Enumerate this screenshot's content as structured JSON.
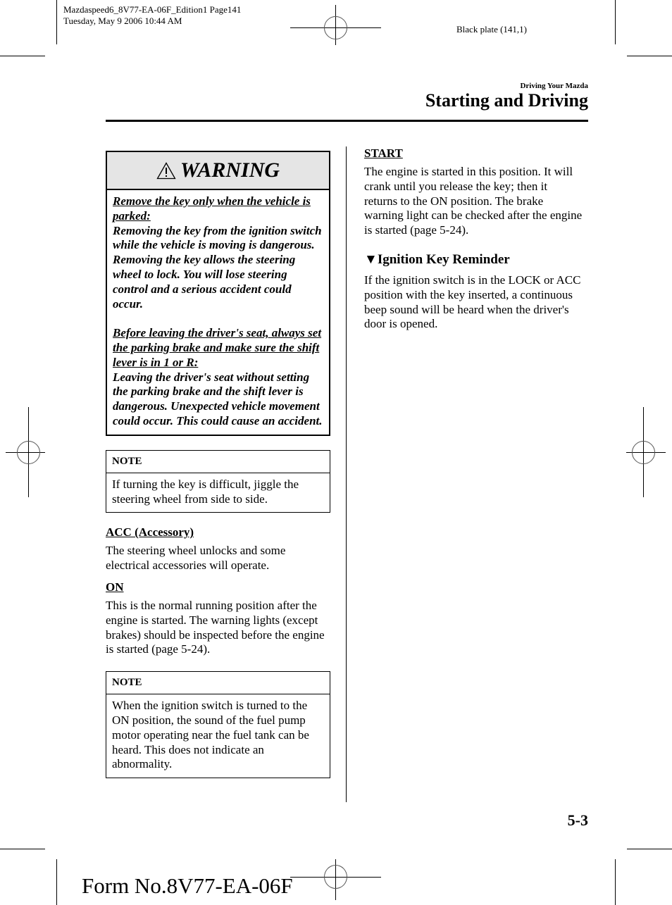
{
  "print_info": {
    "line1": "Mazdaspeed6_8V77-EA-06F_Edition1 Page141",
    "line2": "Tuesday, May 9 2006 10:44 AM",
    "plate": "Black plate (141,1)"
  },
  "header": {
    "chapter": "Driving Your Mazda",
    "section_title": "Starting and Driving"
  },
  "warning": {
    "icon": "warning-triangle-icon",
    "title": "WARNING",
    "blocks": [
      {
        "heading": "Remove the key only when the vehicle is parked:",
        "text": "Removing the key from the ignition switch while the vehicle is moving is dangerous. Removing the key allows the steering wheel to lock. You will lose steering control and a serious accident could occur."
      },
      {
        "heading": "Before leaving the driver's seat, always set the parking brake and make sure the shift lever is in 1 or R:",
        "text": "Leaving the driver's seat without setting the parking brake and the shift lever is dangerous. Unexpected vehicle movement could occur. This could cause an accident."
      }
    ]
  },
  "notes": [
    {
      "label": "NOTE",
      "text": "If turning the key is difficult, jiggle the steering wheel from side to side."
    },
    {
      "label": "NOTE",
      "text": "When the ignition switch is turned to the ON position, the sound of the fuel pump motor operating near the fuel tank can be heard. This does not indicate an abnormality."
    }
  ],
  "positions": {
    "acc": {
      "heading": "ACC (Accessory)",
      "text": "The steering wheel unlocks and some electrical accessories will operate."
    },
    "on": {
      "heading": "ON",
      "text": "This is the normal running position after the engine is started. The warning lights (except brakes) should be inspected before the engine is started (page 5-24)."
    },
    "start": {
      "heading": "START",
      "text": "The engine is started in this position. It will crank until you release the key; then it returns to the ON position. The brake warning light can be checked after the engine is started (page 5-24)."
    }
  },
  "reminder": {
    "icon": "down-triangle-icon",
    "heading": "Ignition Key Reminder",
    "text": "If the ignition switch is in the LOCK or ACC position with the key inserted, a continuous beep sound will be heard when the driver's door is opened."
  },
  "footer": {
    "page_number": "5-3",
    "form_number": "Form No.8V77-EA-06F"
  }
}
